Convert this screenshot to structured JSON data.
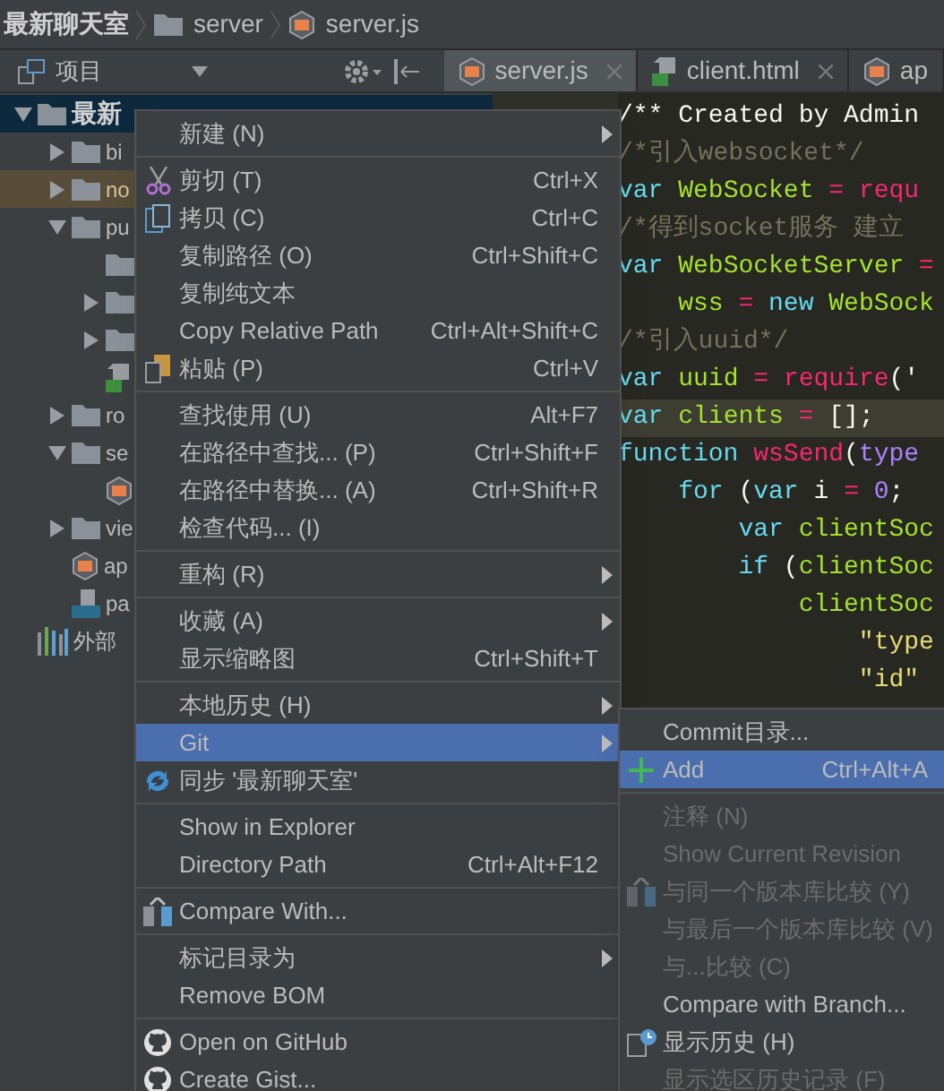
{
  "breadcrumb": [
    {
      "label": "最新聊天室",
      "kind": "root"
    },
    {
      "label": "server",
      "kind": "folder"
    },
    {
      "label": "server.js",
      "kind": "js"
    }
  ],
  "project_panel": {
    "title": "项目"
  },
  "tabs": [
    {
      "label": "server.js",
      "kind": "js",
      "selected": true
    },
    {
      "label": "client.html",
      "kind": "html",
      "selected": false
    },
    {
      "label": "ap",
      "kind": "js",
      "selected": false
    }
  ],
  "tree": [
    {
      "name": "最新",
      "kind": "folder",
      "expanded": true,
      "selected": true,
      "excluded": false,
      "children": [
        {
          "name": "bi",
          "kind": "folder",
          "expanded": false,
          "selected": false,
          "excluded": false
        },
        {
          "name": "no",
          "kind": "folder",
          "expanded": false,
          "selected": false,
          "excluded": true
        },
        {
          "name": "pu",
          "kind": "folder",
          "expanded": true,
          "selected": false,
          "excluded": false,
          "children": [
            {
              "kind": "folder",
              "selected": false,
              "excluded": false
            },
            {
              "kind": "folder",
              "expanded": false,
              "selected": false,
              "excluded": false
            },
            {
              "kind": "folder",
              "expanded": false,
              "selected": false,
              "excluded": false
            },
            {
              "kind": "html",
              "selected": false,
              "excluded": false
            }
          ]
        },
        {
          "name": "ro",
          "kind": "folder",
          "expanded": false,
          "selected": false,
          "excluded": false
        },
        {
          "name": "se",
          "kind": "folder",
          "expanded": true,
          "selected": false,
          "excluded": false,
          "children": [
            {
              "kind": "js",
              "selected": false,
              "excluded": false
            }
          ]
        },
        {
          "name": "vie",
          "kind": "folder",
          "expanded": false,
          "selected": false,
          "excluded": false
        },
        {
          "name": "ap",
          "kind": "js",
          "selected": false,
          "excluded": false
        },
        {
          "name": "pa",
          "kind": "json",
          "selected": false,
          "excluded": false
        }
      ]
    },
    {
      "name": "外部",
      "kind": "library",
      "selected": false,
      "excluded": false
    }
  ],
  "code": [
    {
      "current": false,
      "tokens": [
        {
          "kind": "plain",
          "text": "/** Created by Admin"
        }
      ]
    },
    {
      "current": false,
      "tokens": [
        {
          "kind": "comment",
          "text": "/*引入websocket*/"
        }
      ]
    },
    {
      "current": false,
      "tokens": [
        {
          "kind": "keyword",
          "text": "var"
        },
        {
          "kind": "name",
          "text": " WebSocket"
        },
        {
          "kind": "op",
          "text": " = "
        },
        {
          "kind": "call",
          "text": "requ"
        }
      ]
    },
    {
      "current": false,
      "tokens": [
        {
          "kind": "comment",
          "text": "/*得到socket服务 建立"
        }
      ]
    },
    {
      "current": false,
      "tokens": [
        {
          "kind": "keyword",
          "text": "var"
        },
        {
          "kind": "name",
          "text": " WebSocketServer"
        },
        {
          "kind": "op",
          "text": " ="
        }
      ]
    },
    {
      "current": false,
      "tokens": [
        {
          "kind": "name",
          "text": "    wss"
        },
        {
          "kind": "op",
          "text": " = "
        },
        {
          "kind": "keyword",
          "text": "new"
        },
        {
          "kind": "name",
          "text": " WebSock"
        }
      ]
    },
    {
      "current": false,
      "tokens": [
        {
          "kind": "comment",
          "text": "/*引入uuid*/"
        }
      ]
    },
    {
      "current": false,
      "tokens": [
        {
          "kind": "keyword",
          "text": "var"
        },
        {
          "kind": "name",
          "text": " uuid"
        },
        {
          "kind": "op",
          "text": " = "
        },
        {
          "kind": "call",
          "text": "require"
        },
        {
          "kind": "plain",
          "text": "('"
        }
      ]
    },
    {
      "current": true,
      "tokens": [
        {
          "kind": "keyword",
          "text": "var"
        },
        {
          "kind": "name",
          "text": " clients"
        },
        {
          "kind": "op",
          "text": " = "
        },
        {
          "kind": "plain",
          "text": "[];"
        }
      ]
    },
    {
      "current": false,
      "tokens": [
        {
          "kind": "keyword",
          "text": "function"
        },
        {
          "kind": "call",
          "text": " wsSend"
        },
        {
          "kind": "plain",
          "text": "("
        },
        {
          "kind": "param",
          "text": "type"
        }
      ]
    },
    {
      "current": false,
      "tokens": [
        {
          "kind": "keyword",
          "text": "    for"
        },
        {
          "kind": "plain",
          "text": " ("
        },
        {
          "kind": "keyword",
          "text": "var"
        },
        {
          "kind": "plain",
          "text": " i "
        },
        {
          "kind": "op",
          "text": "="
        },
        {
          "kind": "number",
          "text": " 0"
        },
        {
          "kind": "plain",
          "text": ";"
        }
      ]
    },
    {
      "current": false,
      "tokens": [
        {
          "kind": "keyword",
          "text": "        var"
        },
        {
          "kind": "name",
          "text": " clientSoc"
        }
      ]
    },
    {
      "current": false,
      "tokens": [
        {
          "kind": "keyword",
          "text": "        if"
        },
        {
          "kind": "plain",
          "text": " ("
        },
        {
          "kind": "name",
          "text": "clientSoc"
        }
      ]
    },
    {
      "current": false,
      "tokens": [
        {
          "kind": "name",
          "text": "            clientSoc"
        }
      ]
    },
    {
      "current": false,
      "tokens": [
        {
          "kind": "string",
          "text": "                \"type"
        }
      ]
    },
    {
      "current": false,
      "tokens": [
        {
          "kind": "string",
          "text": "                \"id\""
        }
      ]
    }
  ],
  "context_menu": [
    {
      "kind": "plain",
      "label": "新建 (N)",
      "submenu": true,
      "selected": false
    },
    {
      "kind": "separator"
    },
    {
      "kind": "scissors",
      "label": "剪切 (T)",
      "shortcut": "Ctrl+X",
      "selected": false
    },
    {
      "kind": "copy",
      "label": "拷贝 (C)",
      "shortcut": "Ctrl+C",
      "selected": false
    },
    {
      "kind": "plain",
      "label": "复制路径 (O)",
      "shortcut": "Ctrl+Shift+C",
      "selected": false
    },
    {
      "kind": "plain",
      "label": "复制纯文本",
      "selected": false
    },
    {
      "kind": "plain",
      "label": "Copy Relative Path",
      "shortcut": "Ctrl+Alt+Shift+C",
      "selected": false
    },
    {
      "kind": "paste",
      "label": "粘贴 (P)",
      "shortcut": "Ctrl+V",
      "selected": false
    },
    {
      "kind": "separator"
    },
    {
      "kind": "plain",
      "label": "查找使用 (U)",
      "shortcut": "Alt+F7",
      "selected": false
    },
    {
      "kind": "plain",
      "label": "在路径中查找... (P)",
      "shortcut": "Ctrl+Shift+F",
      "selected": false
    },
    {
      "kind": "plain",
      "label": "在路径中替换... (A)",
      "shortcut": "Ctrl+Shift+R",
      "selected": false
    },
    {
      "kind": "plain",
      "label": "检查代码... (I)",
      "selected": false
    },
    {
      "kind": "separator"
    },
    {
      "kind": "plain",
      "label": "重构 (R)",
      "submenu": true,
      "selected": false
    },
    {
      "kind": "separator"
    },
    {
      "kind": "plain",
      "label": "收藏 (A)",
      "submenu": true,
      "selected": false
    },
    {
      "kind": "plain",
      "label": "显示缩略图",
      "shortcut": "Ctrl+Shift+T",
      "selected": false
    },
    {
      "kind": "separator"
    },
    {
      "kind": "plain",
      "label": "本地历史 (H)",
      "submenu": true,
      "selected": false
    },
    {
      "kind": "plain",
      "label": "Git",
      "submenu": true,
      "selected": true
    },
    {
      "kind": "sync",
      "label": "同步 '最新聊天室'",
      "selected": false
    },
    {
      "kind": "separator"
    },
    {
      "kind": "plain",
      "label": "Show in Explorer",
      "selected": false
    },
    {
      "kind": "plain",
      "label": "Directory Path",
      "shortcut": "Ctrl+Alt+F12",
      "selected": false
    },
    {
      "kind": "separator"
    },
    {
      "kind": "compare",
      "label": "Compare With...",
      "selected": false
    },
    {
      "kind": "separator"
    },
    {
      "kind": "plain",
      "label": "标记目录为",
      "submenu": true,
      "selected": false
    },
    {
      "kind": "plain",
      "label": "Remove BOM",
      "selected": false
    },
    {
      "kind": "separator"
    },
    {
      "kind": "github",
      "label": "Open on GitHub",
      "selected": false
    },
    {
      "kind": "github",
      "label": "Create Gist...",
      "selected": false
    }
  ],
  "git_submenu": [
    {
      "kind": "plain",
      "label": "Commit目录...",
      "disabled": false,
      "selected": false
    },
    {
      "kind": "plus",
      "label": "Add",
      "shortcut": "Ctrl+Alt+A",
      "disabled": false,
      "selected": true
    },
    {
      "kind": "separator"
    },
    {
      "kind": "plain",
      "label": "注释 (N)",
      "disabled": true,
      "selected": false
    },
    {
      "kind": "plain",
      "label": "Show Current Revision",
      "disabled": true,
      "selected": false
    },
    {
      "kind": "compare",
      "label": "与同一个版本库比较 (Y)",
      "disabled": true,
      "selected": false
    },
    {
      "kind": "plain",
      "label": "与最后一个版本库比较 (V)",
      "disabled": true,
      "selected": false
    },
    {
      "kind": "plain",
      "label": "与...比较 (C)",
      "disabled": true,
      "selected": false
    },
    {
      "kind": "plain",
      "label": "Compare with Branch...",
      "disabled": false,
      "selected": false
    },
    {
      "kind": "history",
      "label": "显示历史 (H)",
      "disabled": false,
      "selected": false
    },
    {
      "kind": "plain",
      "label": "显示选区历史记录 (F)",
      "disabled": true,
      "selected": false
    }
  ]
}
